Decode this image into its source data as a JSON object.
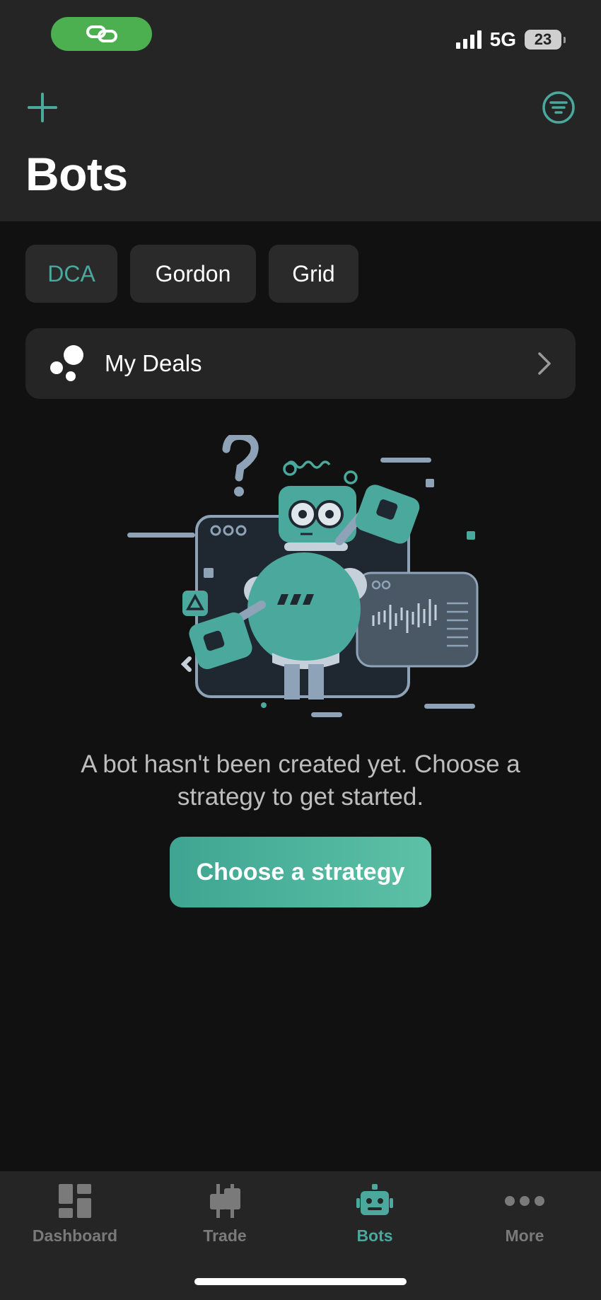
{
  "status_bar": {
    "network": "5G",
    "battery": "23",
    "link_icon": "link-icon"
  },
  "header": {
    "add_icon": "plus-icon",
    "filter_icon": "filter-icon",
    "title": "Bots"
  },
  "tabs": [
    {
      "label": "DCA",
      "active": true
    },
    {
      "label": "Gordon",
      "active": false
    },
    {
      "label": "Grid",
      "active": false
    }
  ],
  "deals": {
    "label": "My Deals",
    "icon": "bubbles-icon"
  },
  "empty_state": {
    "message": "A bot hasn't been created yet. Choose a strategy to get started.",
    "cta_label": "Choose a strategy"
  },
  "tabbar": {
    "items": [
      {
        "label": "Dashboard",
        "icon": "dashboard-icon",
        "active": false
      },
      {
        "label": "Trade",
        "icon": "trade-icon",
        "active": false
      },
      {
        "label": "Bots",
        "icon": "bot-icon",
        "active": true
      },
      {
        "label": "More",
        "icon": "more-icon",
        "active": false
      }
    ]
  },
  "colors": {
    "accent": "#4aa89d",
    "background": "#111111",
    "surface": "#252525",
    "status_pill": "#4caf50"
  }
}
